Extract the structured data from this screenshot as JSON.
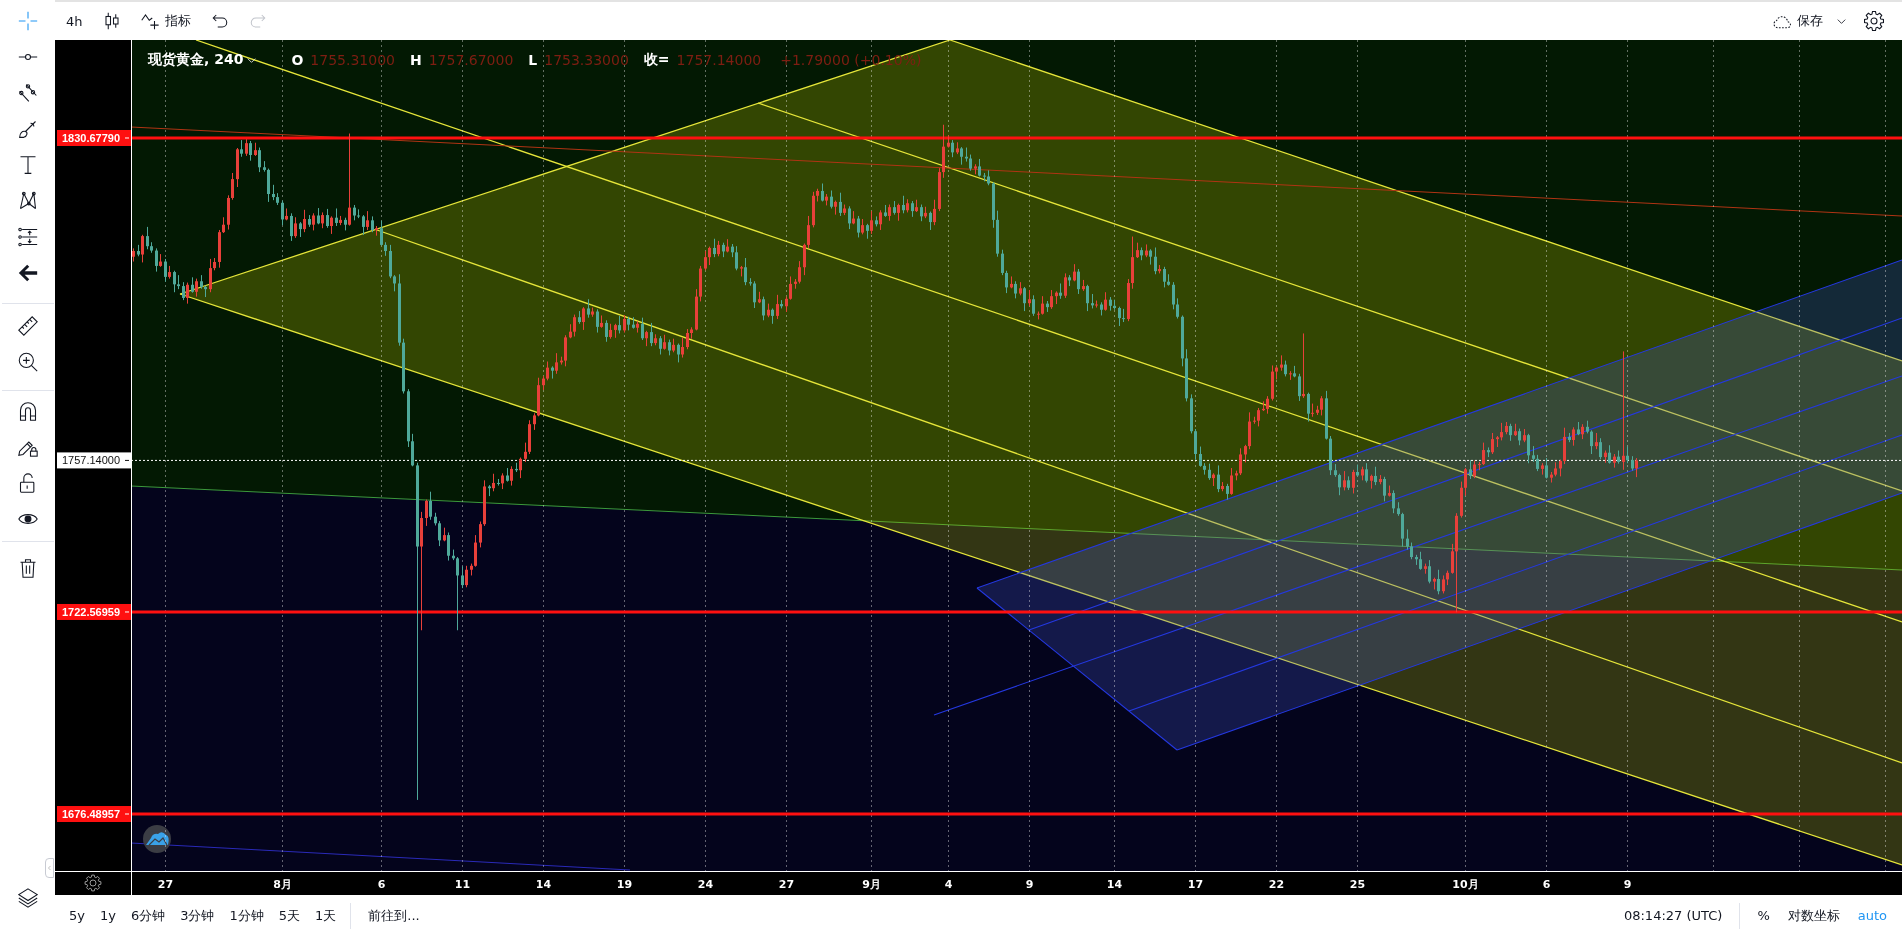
{
  "toolbar": {
    "interval": "4h",
    "indicators_label": "指标",
    "undo": {
      "disabled": false
    },
    "redo": {
      "disabled": true
    },
    "save_label": "保存"
  },
  "left_toolbar": {
    "groups": [
      {
        "tools": [
          {
            "selected": true
          },
          {
            "selected": false
          },
          {
            "selected": false
          },
          {
            "selected": false
          },
          {
            "selected": false
          },
          {
            "selected": false
          },
          {
            "selected": false
          },
          {
            "selected": false
          }
        ]
      },
      {
        "tools": [
          {
            "selected": false
          },
          {
            "selected": false
          }
        ]
      },
      {
        "tools": [
          {
            "selected": false
          },
          {
            "selected": false
          },
          {
            "selected": false
          },
          {
            "selected": false
          }
        ]
      },
      {
        "tools": [
          {
            "selected": false
          }
        ]
      }
    ]
  },
  "chart": {
    "legend": {
      "symbol": "现货黄金, 240",
      "fields": [
        {
          "label": "O",
          "value": "1755.31000"
        },
        {
          "label": "H",
          "value": "1757.67000"
        },
        {
          "label": "L",
          "value": "1753.33000"
        },
        {
          "label": "收=",
          "value": "1757.14000"
        }
      ],
      "change": "+1.79000 (+0.10%)"
    },
    "chart_data": {
      "type": "candlestick",
      "grid": true,
      "ylim": [
        1663.49,
        1853.03
      ],
      "yticks": [
        {
          "value": 1830.6779,
          "label": "1830.67790"
        },
        {
          "value": 1757.14,
          "label": "1757.14000"
        },
        {
          "value": 1722.56959,
          "label": "1722.56959"
        },
        {
          "value": 1676.48957,
          "label": "1676.48957"
        }
      ],
      "ref_lines": [
        {
          "axis": "y",
          "value": 1830.6779,
          "color": "#ff1010"
        },
        {
          "axis": "y",
          "value": 1757.14,
          "color": "#ffffff"
        },
        {
          "axis": "y",
          "value": 1722.56959,
          "color": "#ff1010"
        },
        {
          "axis": "y",
          "value": 1676.48957,
          "color": "#ff1010"
        }
      ],
      "categories": [
        null,
        null,
        null,
        null,
        null,
        null,
        null,
        "27",
        null,
        null,
        null,
        null,
        null,
        null,
        null,
        null,
        null,
        null,
        null,
        null,
        null,
        null,
        null,
        null,
        null,
        null,
        null,
        null,
        null,
        null,
        null,
        null,
        null,
        "8月",
        null,
        null,
        null,
        null,
        null,
        null,
        null,
        null,
        null,
        null,
        null,
        null,
        null,
        null,
        null,
        null,
        null,
        null,
        null,
        null,
        null,
        "6",
        null,
        null,
        null,
        null,
        null,
        null,
        null,
        null,
        null,
        null,
        null,
        null,
        null,
        null,
        null,
        null,
        null,
        "11",
        null,
        null,
        null,
        null,
        null,
        null,
        null,
        null,
        null,
        null,
        null,
        null,
        null,
        null,
        null,
        null,
        null,
        "14",
        null,
        null,
        null,
        null,
        null,
        null,
        null,
        null,
        null,
        null,
        null,
        null,
        null,
        null,
        null,
        null,
        null,
        "19",
        null,
        null,
        null,
        null,
        null,
        null,
        null,
        null,
        null,
        null,
        null,
        null,
        null,
        null,
        null,
        null,
        null,
        "24",
        null,
        null,
        null,
        null,
        null,
        null,
        null,
        null,
        null,
        null,
        null,
        null,
        null,
        null,
        null,
        null,
        null,
        "27",
        null,
        null,
        null,
        null,
        null,
        null,
        null,
        null,
        null,
        null,
        null,
        null,
        null,
        null,
        null,
        null,
        null,
        null,
        "9月",
        null,
        null,
        null,
        null,
        null,
        null,
        null,
        null,
        null,
        null,
        null,
        null,
        null,
        null,
        null,
        null,
        "4",
        null,
        null,
        null,
        null,
        null,
        null,
        null,
        null,
        null,
        null,
        null,
        null,
        null,
        null,
        null,
        null,
        null,
        "9",
        null,
        null,
        null,
        null,
        null,
        null,
        null,
        null,
        null,
        null,
        null,
        null,
        null,
        null,
        null,
        null,
        null,
        null,
        "14",
        null,
        null,
        null,
        null,
        null,
        null,
        null,
        null,
        null,
        null,
        null,
        null,
        null,
        null,
        null,
        null,
        null,
        "17",
        null,
        null,
        null,
        null,
        null,
        null,
        null,
        null,
        null,
        null,
        null,
        null,
        null,
        null,
        null,
        null,
        null,
        "22",
        null,
        null,
        null,
        null,
        null,
        null,
        null,
        null,
        null,
        null,
        null,
        null,
        null,
        null,
        null,
        null,
        null,
        "25",
        null,
        null,
        null,
        null,
        null,
        null,
        null,
        null,
        null,
        null,
        null,
        null,
        null,
        null,
        null,
        null,
        null,
        null,
        null,
        null,
        null,
        null,
        null,
        "10月",
        null,
        null,
        null,
        null,
        null,
        null,
        null,
        null,
        null,
        null,
        null,
        null,
        null,
        null,
        null,
        null,
        null,
        "6",
        null,
        null,
        null,
        null,
        null,
        null,
        null,
        null,
        null,
        null,
        null,
        null,
        null,
        null,
        null,
        null,
        null,
        "9",
        null,
        null
      ],
      "ohlc": [
        [
          1803.6,
          1805.5,
          1802.5,
          1804.9
        ],
        [
          1804.9,
          1806.3,
          1803.7,
          1804.1
        ],
        [
          1804.1,
          1808.6,
          1802.3,
          1808.3
        ],
        [
          1808.3,
          1810.4,
          1805.3,
          1806.0
        ],
        [
          1806.0,
          1806.9,
          1804.5,
          1805.0
        ],
        [
          1805.0,
          1805.5,
          1800.2,
          1801.5
        ],
        [
          1801.5,
          1804.2,
          1801.3,
          1802.5
        ],
        [
          1802.5,
          1803.1,
          1797.9,
          1799.0
        ],
        [
          1799.0,
          1801.5,
          1798.6,
          1800.1
        ],
        [
          1800.1,
          1800.4,
          1795.5,
          1797.3
        ],
        [
          1797.3,
          1799.4,
          1796.2,
          1796.9
        ],
        [
          1796.9,
          1797.8,
          1793.7,
          1794.2
        ],
        [
          1794.2,
          1797.7,
          1792.9,
          1797.2
        ],
        [
          1797.2,
          1798.9,
          1795.4,
          1795.6
        ],
        [
          1795.6,
          1798.6,
          1794.5,
          1798.0
        ],
        [
          1798.0,
          1799.4,
          1796.3,
          1796.7
        ],
        [
          1796.7,
          1797.0,
          1794.4,
          1796.2
        ],
        [
          1796.2,
          1803.1,
          1795.5,
          1801.0
        ],
        [
          1801.0,
          1803.3,
          1800.5,
          1802.4
        ],
        [
          1802.4,
          1809.7,
          1801.1,
          1809.2
        ],
        [
          1809.2,
          1812.6,
          1809.0,
          1810.9
        ],
        [
          1810.9,
          1817.6,
          1809.8,
          1817.0
        ],
        [
          1817.0,
          1822.7,
          1816.6,
          1821.3
        ],
        [
          1821.3,
          1828.4,
          1819.5,
          1828.1
        ],
        [
          1828.1,
          1830.2,
          1826.4,
          1827.1
        ],
        [
          1827.1,
          1830.4,
          1826.6,
          1829.5
        ],
        [
          1829.5,
          1830.0,
          1825.5,
          1826.8
        ],
        [
          1826.8,
          1829.6,
          1826.6,
          1827.9
        ],
        [
          1827.9,
          1828.5,
          1822.9,
          1824.0
        ],
        [
          1824.0,
          1825.4,
          1823.0,
          1823.4
        ],
        [
          1823.4,
          1823.7,
          1816.1,
          1817.9
        ],
        [
          1817.9,
          1820.0,
          1816.5,
          1817.2
        ],
        [
          1817.2,
          1818.1,
          1815.4,
          1815.9
        ],
        [
          1815.9,
          1816.4,
          1810.8,
          1812.1
        ],
        [
          1812.1,
          1814.6,
          1811.9,
          1812.9
        ],
        [
          1812.9,
          1813.5,
          1807.2,
          1808.3
        ],
        [
          1808.3,
          1812.6,
          1807.9,
          1811.2
        ],
        [
          1811.2,
          1811.5,
          1808.1,
          1809.9
        ],
        [
          1809.9,
          1814.3,
          1809.2,
          1812.2
        ],
        [
          1812.2,
          1813.1,
          1810.4,
          1810.9
        ],
        [
          1810.9,
          1813.5,
          1809.6,
          1813.0
        ],
        [
          1813.0,
          1814.7,
          1811.0,
          1811.2
        ],
        [
          1811.2,
          1813.7,
          1810.1,
          1813.1
        ],
        [
          1813.1,
          1814.5,
          1810.2,
          1810.6
        ],
        [
          1810.6,
          1812.8,
          1808.8,
          1812.5
        ],
        [
          1812.5,
          1814.6,
          1810.6,
          1811.3
        ],
        [
          1811.3,
          1812.9,
          1810.8,
          1812.0
        ],
        [
          1812.0,
          1812.5,
          1809.6,
          1810.9
        ],
        [
          1810.9,
          1831.7,
          1810.7,
          1814.8
        ],
        [
          1814.8,
          1815.4,
          1811.9,
          1813.0
        ],
        [
          1813.0,
          1814.4,
          1812.4,
          1812.8
        ],
        [
          1812.8,
          1813.1,
          1808.6,
          1810.4
        ],
        [
          1810.4,
          1814.0,
          1809.7,
          1811.9
        ],
        [
          1811.9,
          1812.8,
          1809.2,
          1809.7
        ],
        [
          1809.7,
          1810.6,
          1808.4,
          1810.1
        ],
        [
          1810.1,
          1811.8,
          1806.1,
          1806.3
        ],
        [
          1806.3,
          1806.9,
          1803.8,
          1804.9
        ],
        [
          1804.9,
          1806.3,
          1798.7,
          1799.1
        ],
        [
          1799.1,
          1799.4,
          1795.7,
          1797.5
        ],
        [
          1797.5,
          1799.6,
          1783.3,
          1784.0
        ],
        [
          1784.0,
          1784.9,
          1772.4,
          1772.9
        ],
        [
          1772.9,
          1773.4,
          1760.2,
          1761.5
        ],
        [
          1761.5,
          1763.2,
          1755.8,
          1756.0
        ],
        [
          1756.0,
          1756.6,
          1679.7,
          1737.5
        ],
        [
          1737.5,
          1745.4,
          1718.4,
          1744.0
        ],
        [
          1744.0,
          1748.2,
          1742.2,
          1747.9
        ],
        [
          1747.9,
          1750.0,
          1743.6,
          1744.3
        ],
        [
          1744.3,
          1745.2,
          1742.3,
          1742.8
        ],
        [
          1742.8,
          1743.3,
          1737.6,
          1738.9
        ],
        [
          1738.9,
          1741.8,
          1738.7,
          1740.1
        ],
        [
          1740.1,
          1740.7,
          1734.3,
          1735.4
        ],
        [
          1735.4,
          1736.8,
          1734.4,
          1734.8
        ],
        [
          1734.8,
          1735.1,
          1718.4,
          1730.9
        ],
        [
          1730.9,
          1733.0,
          1728.0,
          1728.7
        ],
        [
          1728.7,
          1733.1,
          1728.2,
          1732.2
        ],
        [
          1732.2,
          1733.6,
          1730.9,
          1733.1
        ],
        [
          1733.1,
          1740.1,
          1732.9,
          1738.4
        ],
        [
          1738.4,
          1743.2,
          1737.3,
          1742.6
        ],
        [
          1742.6,
          1752.6,
          1742.2,
          1751.2
        ],
        [
          1751.2,
          1751.5,
          1749.0,
          1750.8
        ],
        [
          1750.8,
          1754.1,
          1750.1,
          1752.0
        ],
        [
          1752.0,
          1752.9,
          1751.4,
          1751.9
        ],
        [
          1751.9,
          1754.2,
          1750.6,
          1753.7
        ],
        [
          1753.7,
          1755.4,
          1752.3,
          1752.5
        ],
        [
          1752.5,
          1755.8,
          1751.4,
          1755.2
        ],
        [
          1755.2,
          1756.6,
          1754.5,
          1754.9
        ],
        [
          1754.9,
          1757.8,
          1753.1,
          1757.5
        ],
        [
          1757.5,
          1761.2,
          1756.8,
          1759.1
        ],
        [
          1759.1,
          1766.3,
          1758.6,
          1765.4
        ],
        [
          1765.4,
          1767.9,
          1764.1,
          1767.4
        ],
        [
          1767.4,
          1776.0,
          1767.2,
          1774.3
        ],
        [
          1774.3,
          1776.4,
          1773.2,
          1775.8
        ],
        [
          1775.8,
          1779.7,
          1775.4,
          1778.3
        ],
        [
          1778.3,
          1778.6,
          1775.8,
          1777.6
        ],
        [
          1777.6,
          1781.6,
          1776.9,
          1779.5
        ],
        [
          1779.5,
          1780.8,
          1779.0,
          1779.9
        ],
        [
          1779.9,
          1785.7,
          1778.6,
          1785.2
        ],
        [
          1785.2,
          1788.2,
          1785.0,
          1786.5
        ],
        [
          1786.5,
          1790.4,
          1785.4,
          1789.8
        ],
        [
          1789.8,
          1791.2,
          1788.3,
          1788.7
        ],
        [
          1788.7,
          1792.1,
          1786.9,
          1791.8
        ],
        [
          1791.8,
          1793.9,
          1789.7,
          1790.4
        ],
        [
          1790.4,
          1792.0,
          1789.9,
          1791.1
        ],
        [
          1791.1,
          1791.6,
          1786.3,
          1787.6
        ],
        [
          1787.6,
          1790.2,
          1787.4,
          1788.5
        ],
        [
          1788.5,
          1789.1,
          1784.2,
          1785.3
        ],
        [
          1785.3,
          1788.3,
          1784.9,
          1786.9
        ],
        [
          1786.9,
          1788.3,
          1785.1,
          1788.0
        ],
        [
          1788.0,
          1790.1,
          1786.1,
          1786.8
        ],
        [
          1786.8,
          1790.3,
          1786.3,
          1789.4
        ],
        [
          1789.4,
          1789.9,
          1786.8,
          1788.1
        ],
        [
          1788.1,
          1789.8,
          1787.2,
          1787.4
        ],
        [
          1787.4,
          1788.9,
          1786.3,
          1788.3
        ],
        [
          1788.3,
          1789.7,
          1784.6,
          1785.0
        ],
        [
          1785.0,
          1786.7,
          1783.2,
          1786.4
        ],
        [
          1786.4,
          1788.5,
          1783.2,
          1783.9
        ],
        [
          1783.9,
          1785.9,
          1783.4,
          1785.0
        ],
        [
          1785.0,
          1785.5,
          1781.3,
          1782.6
        ],
        [
          1782.6,
          1785.8,
          1782.4,
          1784.1
        ],
        [
          1784.1,
          1784.7,
          1781.1,
          1782.2
        ],
        [
          1782.2,
          1784.9,
          1781.8,
          1783.5
        ],
        [
          1783.5,
          1783.8,
          1779.5,
          1781.3
        ],
        [
          1781.3,
          1785.1,
          1780.6,
          1783.0
        ],
        [
          1783.0,
          1787.1,
          1782.5,
          1786.2
        ],
        [
          1786.2,
          1787.5,
          1784.9,
          1787.0
        ],
        [
          1787.0,
          1796.2,
          1786.8,
          1794.5
        ],
        [
          1794.5,
          1801.5,
          1793.4,
          1800.9
        ],
        [
          1800.9,
          1804.9,
          1800.5,
          1803.5
        ],
        [
          1803.5,
          1805.9,
          1801.7,
          1805.6
        ],
        [
          1805.6,
          1807.7,
          1803.5,
          1804.2
        ],
        [
          1804.2,
          1807.2,
          1803.7,
          1806.3
        ],
        [
          1806.3,
          1806.8,
          1803.5,
          1804.8
        ],
        [
          1804.8,
          1807.6,
          1804.6,
          1805.9
        ],
        [
          1805.9,
          1806.5,
          1803.5,
          1804.6
        ],
        [
          1804.6,
          1806.0,
          1800.5,
          1800.9
        ],
        [
          1800.9,
          1801.5,
          1799.1,
          1801.2
        ],
        [
          1801.2,
          1803.3,
          1797.1,
          1797.8
        ],
        [
          1797.8,
          1798.7,
          1797.0,
          1797.5
        ],
        [
          1797.5,
          1798.0,
          1791.9,
          1793.2
        ],
        [
          1793.2,
          1795.6,
          1793.0,
          1793.9
        ],
        [
          1793.9,
          1794.5,
          1789.1,
          1790.2
        ],
        [
          1790.2,
          1792.9,
          1789.8,
          1791.5
        ],
        [
          1791.5,
          1791.8,
          1788.3,
          1790.1
        ],
        [
          1790.1,
          1794.9,
          1789.4,
          1792.8
        ],
        [
          1792.8,
          1793.7,
          1791.8,
          1792.3
        ],
        [
          1792.3,
          1794.5,
          1791.0,
          1794.0
        ],
        [
          1794.0,
          1799.1,
          1793.8,
          1797.4
        ],
        [
          1797.4,
          1798.5,
          1796.3,
          1797.9
        ],
        [
          1797.9,
          1802.6,
          1797.5,
          1801.2
        ],
        [
          1801.2,
          1806.6,
          1799.4,
          1806.3
        ],
        [
          1806.3,
          1812.9,
          1805.6,
          1810.8
        ],
        [
          1810.8,
          1818.4,
          1810.3,
          1817.5
        ],
        [
          1817.5,
          1819.1,
          1816.2,
          1818.6
        ],
        [
          1818.6,
          1820.3,
          1816.2,
          1816.4
        ],
        [
          1816.4,
          1817.9,
          1815.3,
          1817.3
        ],
        [
          1817.3,
          1818.7,
          1814.6,
          1815.0
        ],
        [
          1815.0,
          1816.4,
          1813.2,
          1816.1
        ],
        [
          1816.1,
          1818.2,
          1812.9,
          1813.6
        ],
        [
          1813.6,
          1815.5,
          1813.1,
          1814.6
        ],
        [
          1814.6,
          1815.1,
          1809.9,
          1811.2
        ],
        [
          1811.2,
          1814.0,
          1811.0,
          1812.3
        ],
        [
          1812.3,
          1812.9,
          1808.0,
          1809.1
        ],
        [
          1809.1,
          1812.2,
          1808.7,
          1810.8
        ],
        [
          1810.8,
          1811.1,
          1807.7,
          1809.5
        ],
        [
          1809.5,
          1814.0,
          1808.8,
          1811.9
        ],
        [
          1811.9,
          1812.8,
          1810.5,
          1811.0
        ],
        [
          1811.0,
          1814.2,
          1809.7,
          1813.7
        ],
        [
          1813.7,
          1815.4,
          1812.7,
          1812.9
        ],
        [
          1812.9,
          1815.5,
          1811.8,
          1814.9
        ],
        [
          1814.9,
          1816.3,
          1813.2,
          1813.6
        ],
        [
          1813.6,
          1815.7,
          1811.8,
          1815.4
        ],
        [
          1815.4,
          1817.5,
          1813.5,
          1814.2
        ],
        [
          1814.2,
          1816.7,
          1813.7,
          1815.8
        ],
        [
          1815.8,
          1816.3,
          1812.7,
          1814.0
        ],
        [
          1814.0,
          1816.6,
          1813.8,
          1814.9
        ],
        [
          1814.9,
          1815.5,
          1811.7,
          1812.8
        ],
        [
          1812.8,
          1815.0,
          1812.4,
          1813.6
        ],
        [
          1813.6,
          1813.9,
          1809.7,
          1811.5
        ],
        [
          1811.5,
          1816.6,
          1810.8,
          1814.5
        ],
        [
          1814.5,
          1823.8,
          1814.0,
          1822.9
        ],
        [
          1822.9,
          1833.7,
          1821.6,
          1828.7
        ],
        [
          1828.7,
          1831.3,
          1828.5,
          1829.6
        ],
        [
          1829.6,
          1830.2,
          1826.3,
          1827.4
        ],
        [
          1827.4,
          1829.7,
          1827.0,
          1828.3
        ],
        [
          1828.3,
          1828.6,
          1824.6,
          1826.4
        ],
        [
          1826.4,
          1828.5,
          1825.3,
          1826.0
        ],
        [
          1826.0,
          1826.9,
          1823.2,
          1823.7
        ],
        [
          1823.7,
          1824.7,
          1822.4,
          1824.2
        ],
        [
          1824.2,
          1825.9,
          1821.9,
          1822.1
        ],
        [
          1822.1,
          1822.7,
          1820.8,
          1821.9
        ],
        [
          1821.9,
          1823.3,
          1819.9,
          1820.3
        ],
        [
          1820.3,
          1820.6,
          1810.2,
          1812.0
        ],
        [
          1812.0,
          1814.1,
          1803.6,
          1804.3
        ],
        [
          1804.3,
          1805.2,
          1799.4,
          1799.9
        ],
        [
          1799.9,
          1800.4,
          1795.3,
          1796.6
        ],
        [
          1796.6,
          1799.1,
          1796.4,
          1797.4
        ],
        [
          1797.4,
          1798.0,
          1794.1,
          1795.2
        ],
        [
          1795.2,
          1797.8,
          1794.8,
          1796.4
        ],
        [
          1796.4,
          1796.7,
          1791.2,
          1793.0
        ],
        [
          1793.0,
          1796.0,
          1792.3,
          1793.9
        ],
        [
          1793.9,
          1794.8,
          1790.1,
          1790.6
        ],
        [
          1790.6,
          1791.1,
          1789.3,
          1790.6
        ],
        [
          1790.6,
          1794.6,
          1790.4,
          1792.9
        ],
        [
          1792.9,
          1793.5,
          1791.0,
          1792.1
        ],
        [
          1792.1,
          1796.0,
          1791.7,
          1794.6
        ],
        [
          1794.6,
          1795.7,
          1792.8,
          1795.4
        ],
        [
          1795.4,
          1797.5,
          1794.0,
          1794.7
        ],
        [
          1794.7,
          1799.8,
          1794.2,
          1798.9
        ],
        [
          1798.9,
          1799.4,
          1796.9,
          1798.2
        ],
        [
          1798.2,
          1801.9,
          1798.0,
          1800.2
        ],
        [
          1800.2,
          1800.8,
          1795.1,
          1796.2
        ],
        [
          1796.2,
          1798.3,
          1795.8,
          1796.9
        ],
        [
          1796.9,
          1797.2,
          1791.2,
          1793.0
        ],
        [
          1793.0,
          1795.1,
          1791.8,
          1792.5
        ],
        [
          1792.5,
          1793.6,
          1792.0,
          1792.7
        ],
        [
          1792.7,
          1793.2,
          1790.2,
          1791.5
        ],
        [
          1791.5,
          1795.5,
          1791.3,
          1793.8
        ],
        [
          1793.8,
          1794.4,
          1791.3,
          1792.4
        ],
        [
          1792.4,
          1793.8,
          1791.5,
          1791.9
        ],
        [
          1791.9,
          1792.2,
          1787.8,
          1789.6
        ],
        [
          1789.6,
          1791.7,
          1788.7,
          1789.4
        ],
        [
          1789.4,
          1798.5,
          1788.9,
          1797.6
        ],
        [
          1797.6,
          1808.2,
          1796.3,
          1803.5
        ],
        [
          1803.5,
          1806.8,
          1803.3,
          1805.1
        ],
        [
          1805.1,
          1805.7,
          1802.8,
          1803.9
        ],
        [
          1803.9,
          1806.4,
          1803.5,
          1805.0
        ],
        [
          1805.0,
          1805.3,
          1801.8,
          1803.6
        ],
        [
          1803.6,
          1805.7,
          1799.6,
          1800.3
        ],
        [
          1800.3,
          1801.7,
          1799.8,
          1800.8
        ],
        [
          1800.8,
          1801.3,
          1796.6,
          1797.9
        ],
        [
          1797.9,
          1799.6,
          1797.0,
          1797.2
        ],
        [
          1797.2,
          1797.8,
          1791.6,
          1792.7
        ],
        [
          1792.7,
          1794.1,
          1789.5,
          1789.9
        ],
        [
          1789.9,
          1790.2,
          1778.6,
          1780.4
        ],
        [
          1780.4,
          1782.5,
          1770.6,
          1771.3
        ],
        [
          1771.3,
          1772.2,
          1763.3,
          1763.8
        ],
        [
          1763.8,
          1764.3,
          1757.3,
          1758.6
        ],
        [
          1758.6,
          1760.3,
          1755.7,
          1755.9
        ],
        [
          1755.9,
          1756.5,
          1753.9,
          1755.0
        ],
        [
          1755.0,
          1756.4,
          1752.7,
          1753.1
        ],
        [
          1753.1,
          1754.2,
          1751.3,
          1753.9
        ],
        [
          1753.9,
          1756.0,
          1749.9,
          1750.6
        ],
        [
          1750.6,
          1752.2,
          1750.1,
          1751.3
        ],
        [
          1751.3,
          1751.8,
          1748.2,
          1749.5
        ],
        [
          1749.5,
          1755.4,
          1749.3,
          1753.7
        ],
        [
          1753.7,
          1754.8,
          1752.6,
          1754.2
        ],
        [
          1754.2,
          1759.9,
          1753.8,
          1758.5
        ],
        [
          1758.5,
          1760.7,
          1756.7,
          1760.4
        ],
        [
          1760.4,
          1768.1,
          1759.7,
          1766.0
        ],
        [
          1766.0,
          1767.1,
          1765.5,
          1766.2
        ],
        [
          1766.2,
          1769.1,
          1764.9,
          1768.6
        ],
        [
          1768.6,
          1770.6,
          1768.4,
          1768.9
        ],
        [
          1768.9,
          1771.8,
          1767.8,
          1771.2
        ],
        [
          1771.2,
          1778.8,
          1770.8,
          1777.4
        ],
        [
          1777.4,
          1778.6,
          1775.6,
          1778.3
        ],
        [
          1778.3,
          1781.1,
          1777.6,
          1779.0
        ],
        [
          1779.0,
          1779.9,
          1776.3,
          1776.8
        ],
        [
          1776.8,
          1777.5,
          1775.5,
          1777.0
        ],
        [
          1777.0,
          1778.7,
          1776.1,
          1776.3
        ],
        [
          1776.3,
          1776.9,
          1770.7,
          1771.8
        ],
        [
          1771.8,
          1786.1,
          1771.4,
          1772.3
        ],
        [
          1772.3,
          1772.6,
          1766.0,
          1767.8
        ],
        [
          1767.8,
          1770.1,
          1767.1,
          1768.0
        ],
        [
          1768.0,
          1769.6,
          1767.5,
          1768.7
        ],
        [
          1768.7,
          1771.8,
          1767.4,
          1771.3
        ],
        [
          1771.3,
          1773.0,
          1761.9,
          1762.1
        ],
        [
          1762.1,
          1762.7,
          1753.8,
          1754.9
        ],
        [
          1754.9,
          1756.3,
          1753.4,
          1753.8
        ],
        [
          1753.8,
          1754.1,
          1749.2,
          1751.0
        ],
        [
          1751.0,
          1754.7,
          1750.3,
          1752.6
        ],
        [
          1752.6,
          1753.5,
          1750.4,
          1750.9
        ],
        [
          1750.9,
          1755.0,
          1749.6,
          1754.5
        ],
        [
          1754.5,
          1756.2,
          1753.5,
          1753.7
        ],
        [
          1753.7,
          1755.7,
          1752.6,
          1755.1
        ],
        [
          1755.1,
          1756.5,
          1752.1,
          1752.5
        ],
        [
          1752.5,
          1753.9,
          1750.7,
          1753.6
        ],
        [
          1753.6,
          1755.7,
          1751.5,
          1752.2
        ],
        [
          1752.2,
          1753.8,
          1751.7,
          1752.9
        ],
        [
          1752.9,
          1753.4,
          1747.8,
          1749.1
        ],
        [
          1749.1,
          1751.4,
          1748.9,
          1749.7
        ],
        [
          1749.7,
          1750.3,
          1745.1,
          1746.2
        ],
        [
          1746.2,
          1747.6,
          1744.5,
          1744.9
        ],
        [
          1744.9,
          1745.2,
          1737.5,
          1739.3
        ],
        [
          1739.3,
          1741.4,
          1736.8,
          1737.5
        ],
        [
          1737.5,
          1738.4,
          1734.6,
          1735.1
        ],
        [
          1735.1,
          1735.6,
          1733.3,
          1734.6
        ],
        [
          1734.6,
          1736.3,
          1732.2,
          1732.4
        ],
        [
          1732.4,
          1733.6,
          1731.3,
          1733.0
        ],
        [
          1733.0,
          1734.4,
          1729.1,
          1729.5
        ],
        [
          1729.5,
          1730.4,
          1727.7,
          1730.1
        ],
        [
          1730.1,
          1732.2,
          1726.6,
          1727.3
        ],
        [
          1727.3,
          1730.9,
          1726.8,
          1730.0
        ],
        [
          1730.0,
          1732.0,
          1728.7,
          1731.5
        ],
        [
          1731.5,
          1738.1,
          1731.3,
          1736.4
        ],
        [
          1736.4,
          1745.1,
          1722.5,
          1744.5
        ],
        [
          1744.5,
          1752.3,
          1744.1,
          1750.9
        ],
        [
          1750.9,
          1755.4,
          1749.1,
          1755.1
        ],
        [
          1755.1,
          1757.2,
          1752.9,
          1753.6
        ],
        [
          1753.6,
          1757.1,
          1753.1,
          1756.2
        ],
        [
          1756.2,
          1756.8,
          1754.9,
          1756.3
        ],
        [
          1756.3,
          1761.2,
          1756.1,
          1759.5
        ],
        [
          1759.5,
          1760.1,
          1757.9,
          1759.0
        ],
        [
          1759.0,
          1763.4,
          1758.6,
          1762.0
        ],
        [
          1762.0,
          1762.7,
          1760.2,
          1762.4
        ],
        [
          1762.4,
          1765.7,
          1761.7,
          1763.6
        ],
        [
          1763.6,
          1765.9,
          1763.1,
          1765.0
        ],
        [
          1765.0,
          1765.5,
          1761.6,
          1762.9
        ],
        [
          1762.9,
          1765.5,
          1762.7,
          1763.8
        ],
        [
          1763.8,
          1764.4,
          1760.6,
          1761.7
        ],
        [
          1761.7,
          1764.3,
          1761.3,
          1762.9
        ],
        [
          1762.9,
          1763.2,
          1756.5,
          1758.3
        ],
        [
          1758.3,
          1760.4,
          1756.8,
          1757.5
        ],
        [
          1757.5,
          1758.4,
          1754.7,
          1755.2
        ],
        [
          1755.2,
          1756.5,
          1753.9,
          1756.0
        ],
        [
          1756.0,
          1757.7,
          1753.0,
          1753.2
        ],
        [
          1753.2,
          1754.5,
          1752.1,
          1753.9
        ],
        [
          1753.9,
          1756.7,
          1753.5,
          1755.3
        ],
        [
          1755.3,
          1757.3,
          1753.5,
          1757.0
        ],
        [
          1757.0,
          1764.6,
          1756.3,
          1762.5
        ],
        [
          1762.5,
          1763.4,
          1761.3,
          1761.8
        ],
        [
          1761.8,
          1764.7,
          1760.5,
          1764.2
        ],
        [
          1764.2,
          1765.9,
          1762.9,
          1763.1
        ],
        [
          1763.1,
          1765.4,
          1762.0,
          1764.8
        ],
        [
          1764.8,
          1766.2,
          1763.3,
          1763.7
        ],
        [
          1763.7,
          1764.0,
          1758.6,
          1760.4
        ],
        [
          1760.4,
          1763.4,
          1759.7,
          1761.3
        ],
        [
          1761.3,
          1762.2,
          1757.4,
          1757.9
        ],
        [
          1757.9,
          1759.4,
          1756.6,
          1758.9
        ],
        [
          1758.9,
          1760.6,
          1756.4,
          1756.6
        ],
        [
          1756.6,
          1758.6,
          1755.5,
          1758.0
        ],
        [
          1758.0,
          1759.4,
          1756.4,
          1756.8
        ],
        [
          1756.8,
          1782.0,
          1755.0,
          1758.2
        ],
        [
          1758.2,
          1760.3,
          1756.5,
          1757.2
        ],
        [
          1757.2,
          1758.1,
          1754.8,
          1755.31
        ],
        [
          1755.31,
          1757.67,
          1753.33,
          1757.14
        ]
      ]
    }
  },
  "bottom_bar": {
    "ranges": [
      "5y",
      "1y",
      "6分钟",
      "3分钟",
      "1分钟",
      "5天",
      "1天"
    ],
    "goto": "前往到...",
    "clock": "08:14:27 (UTC)",
    "scale_options": [
      {
        "label": "%",
        "on": false
      },
      {
        "label": "对数坐标",
        "on": false
      },
      {
        "label": "auto",
        "on": true
      }
    ]
  }
}
